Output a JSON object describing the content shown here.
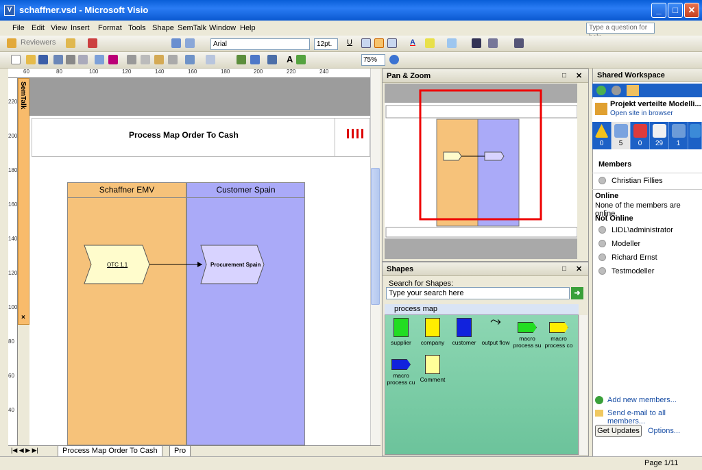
{
  "window": {
    "title": "schaffner.vsd - Microsoft Visio",
    "app_icon": "visio-icon"
  },
  "menu": [
    "File",
    "Edit",
    "View",
    "Insert",
    "Format",
    "Tools",
    "Shape",
    "SemTalk",
    "Window",
    "Help"
  ],
  "help_search_placeholder": "Type a question for help",
  "toolbar": {
    "reviewers": "Reviewers",
    "font": "Arial",
    "font_size": "12pt.",
    "zoom": "75%"
  },
  "semtalk": {
    "label": "SemTalk",
    "close": "×"
  },
  "rulers": {
    "top": [
      "60",
      "80",
      "100",
      "120",
      "140",
      "160",
      "180",
      "200",
      "220",
      "240"
    ],
    "left": [
      "220",
      "200",
      "180",
      "160",
      "140",
      "120",
      "100",
      "80",
      "60",
      "40"
    ]
  },
  "diagram": {
    "title": "Process Map Order To Cash",
    "lanes": [
      "Schaffner EMV",
      "Customer Spain"
    ],
    "shapes": [
      "OTC 1.1",
      "Procurement Spain"
    ]
  },
  "page_tabs": [
    "Process Map Order To Cash",
    "Pro"
  ],
  "panels": {
    "pan_zoom": {
      "title": "Pan & Zoom"
    },
    "shapes": {
      "title": "Shapes",
      "search_label": "Search for Shapes:",
      "search_placeholder": "Type your search here",
      "stencil": "process map",
      "items": [
        {
          "label": "supplier",
          "color": "#22dd22"
        },
        {
          "label": "company",
          "color": "#ffee00"
        },
        {
          "label": "customer",
          "color": "#1122dd"
        },
        {
          "label": "output flow",
          "color": "#dddddd"
        },
        {
          "label": "macro process su",
          "color": "#22dd22"
        },
        {
          "label": "macro process co",
          "color": "#ffee00"
        },
        {
          "label": "macro process cu",
          "color": "#1122dd"
        },
        {
          "label": "Comment",
          "color": "#ffff99"
        }
      ]
    },
    "shared_workspace": {
      "title": "Shared Workspace",
      "project": "Projekt verteilte Modelli...",
      "open_site": "Open site in browser",
      "tab_counts": [
        "0",
        "5",
        "0",
        "29",
        "1",
        ""
      ],
      "members_header": "Members",
      "owner": "Christian Fillies",
      "online_header": "Online",
      "online_text": "None of the members are online.",
      "not_online_header": "Not Online",
      "not_online": [
        "LIDL\\administrator",
        "Modeller",
        "Richard Ernst",
        "Testmodeller"
      ],
      "add_members": "Add new members...",
      "send_email": "Send e-mail to all members...",
      "get_updates": "Get Updates",
      "options": "Options..."
    }
  },
  "status": {
    "page": "Page 1/11"
  },
  "colors": {
    "lane1": "#f6c27a",
    "lane2": "#aaaaf8",
    "accent": "#1c61c6"
  }
}
